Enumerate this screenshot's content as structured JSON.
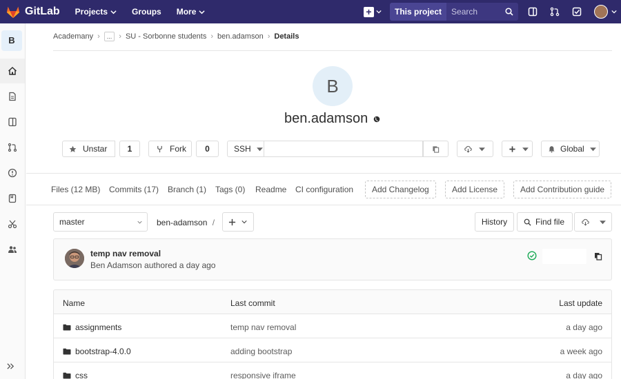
{
  "topbar": {
    "brand": "GitLab",
    "nav": [
      {
        "label": "Projects",
        "has_caret": true
      },
      {
        "label": "Groups",
        "has_caret": false
      },
      {
        "label": "More",
        "has_caret": true
      }
    ],
    "search_scope": "This project",
    "search_placeholder": "Search",
    "icons": [
      "plus-icon",
      "sidebar-toggle-icon",
      "merge-request-icon",
      "todo-check-icon"
    ]
  },
  "sidebar": {
    "avatar_letter": "B",
    "items": [
      "home-icon",
      "file-icon",
      "repository-icon",
      "merge-request-icon",
      "ci-cd-icon",
      "wiki-icon",
      "snippets-icon",
      "members-icon"
    ]
  },
  "breadcrumb": {
    "items": [
      "Academany",
      "...",
      "SU - Sorbonne students",
      "ben.adamson"
    ],
    "current": "Details"
  },
  "project": {
    "avatar_letter": "B",
    "name": "ben.adamson"
  },
  "actions": {
    "unstar_label": "Unstar",
    "star_count": "1",
    "fork_label": "Fork",
    "fork_count": "0",
    "clone_protocol": "SSH",
    "notification_label": "Global"
  },
  "stats": {
    "files": "Files (12 MB)",
    "commits": "Commits (17)",
    "branches": "Branch (1)",
    "tags": "Tags (0)",
    "readme": "Readme",
    "ci": "CI configuration",
    "add_changelog": "Add Changelog",
    "add_license": "Add License",
    "add_contribution": "Add Contribution guide"
  },
  "branch_row": {
    "branch": "master",
    "path": "ben-adamson",
    "path_sep": "/",
    "history": "History",
    "find_file": "Find file"
  },
  "last_commit": {
    "title": "temp nav removal",
    "meta": "Ben Adamson authored a day ago"
  },
  "tree": {
    "headers": {
      "name": "Name",
      "commit": "Last commit",
      "update": "Last update"
    },
    "rows": [
      {
        "name": "assignments",
        "commit": "temp nav removal",
        "update": "a day ago"
      },
      {
        "name": "bootstrap-4.0.0",
        "commit": "adding bootstrap",
        "update": "a week ago"
      },
      {
        "name": "css",
        "commit": "responsive iframe",
        "update": "a day ago"
      }
    ]
  },
  "colors": {
    "navbar": "#2f2a6b",
    "success": "#1aaa55"
  }
}
